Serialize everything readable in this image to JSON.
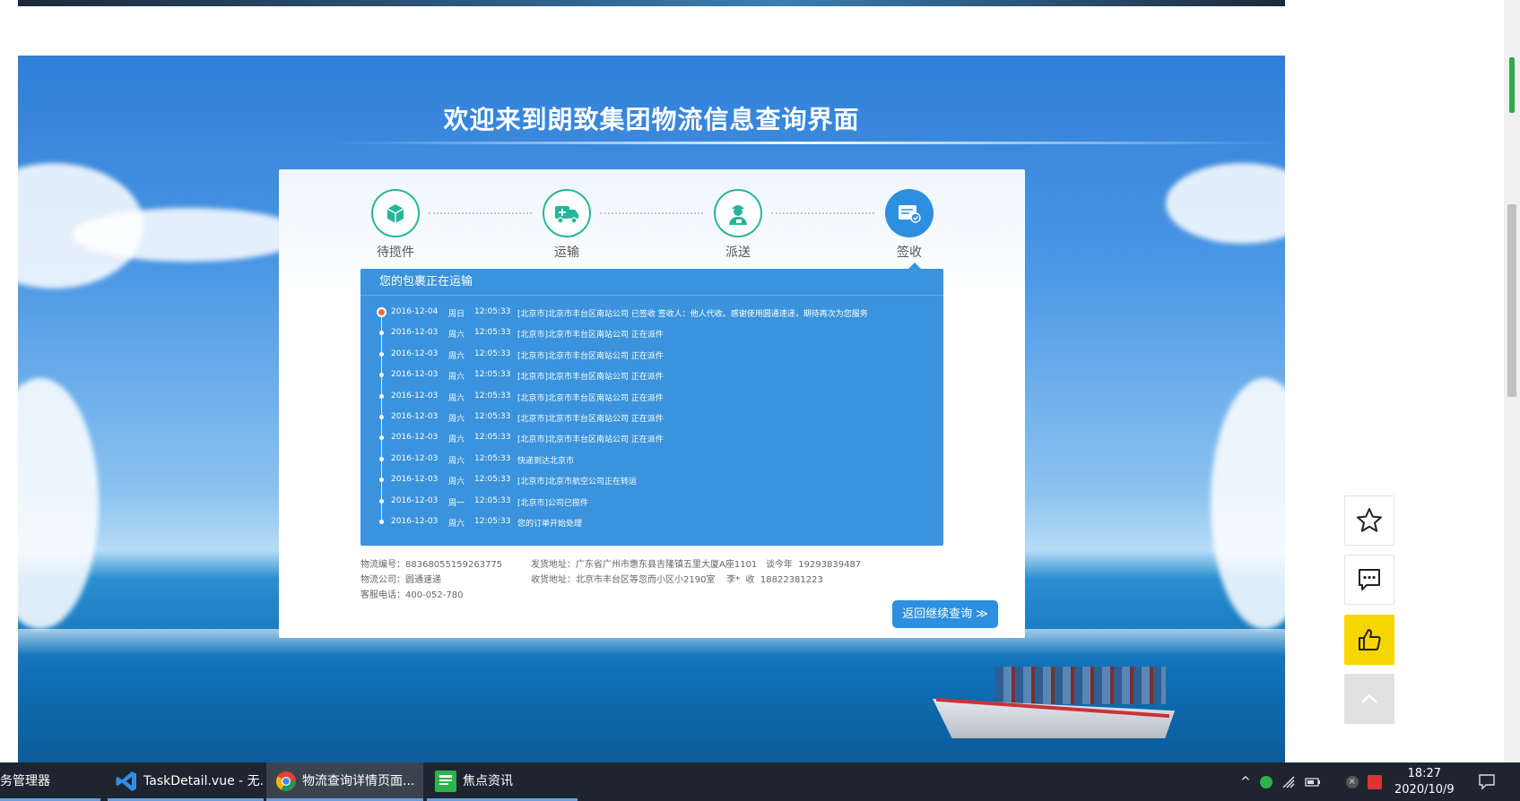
{
  "banner": {
    "title": "欢迎来到朗致集团物流信息查询界面"
  },
  "steps": [
    {
      "label": "待揽件",
      "icon": "box-icon"
    },
    {
      "label": "运输",
      "icon": "truck-icon"
    },
    {
      "label": "派送",
      "icon": "courier-icon"
    },
    {
      "label": "签收",
      "icon": "signed-receipt-icon"
    }
  ],
  "tracking": {
    "header": "您的包裹正在运输",
    "events": [
      {
        "date": "2016-12-04",
        "week": "周日",
        "time": "12:05:33",
        "text": "[北京市]北京市丰台区南站公司 已签收 签收人：他人代收。感谢使用圆通速递，期待再次为您服务"
      },
      {
        "date": "2016-12-03",
        "week": "周六",
        "time": "12:05:33",
        "text": "[北京市]北京市丰台区南站公司 正在派件"
      },
      {
        "date": "2016-12-03",
        "week": "周六",
        "time": "12:05:33",
        "text": "[北京市]北京市丰台区南站公司 正在派件"
      },
      {
        "date": "2016-12-03",
        "week": "周六",
        "time": "12:05:33",
        "text": "[北京市]北京市丰台区南站公司 正在派件"
      },
      {
        "date": "2016-12-03",
        "week": "周六",
        "time": "12:05:33",
        "text": "[北京市]北京市丰台区南站公司 正在派件"
      },
      {
        "date": "2016-12-03",
        "week": "周六",
        "time": "12:05:33",
        "text": "[北京市]北京市丰台区南站公司 正在派件"
      },
      {
        "date": "2016-12-03",
        "week": "周六",
        "time": "12:05:33",
        "text": "[北京市]北京市丰台区南站公司 正在派件"
      },
      {
        "date": "2016-12-03",
        "week": "周六",
        "time": "12:05:33",
        "text": "快递到达北京市"
      },
      {
        "date": "2016-12-03",
        "week": "周六",
        "time": "12:05:33",
        "text": "[北京市]北京市航空公司正在转运"
      },
      {
        "date": "2016-12-03",
        "week": "周一",
        "time": "12:05:33",
        "text": "[北京市]公司已揽件"
      },
      {
        "date": "2016-12-03",
        "week": "周六",
        "time": "12:05:33",
        "text": "您的订单开始处理"
      }
    ]
  },
  "info": {
    "tracking_no": "物流编号：88368055159263775",
    "company": "物流公司：圆通速递",
    "phone": "客服电话：400-052-780",
    "sender": "发货地址：广东省广州市惠东县吉隆镇五里大厦A座1101   谈今年  19293839487",
    "receiver": "收货地址：北京市丰台区等忽而小区小2190室    李*  收  18822381223"
  },
  "return_button": "返回继续查询 ≫",
  "side_buttons": [
    "star-icon",
    "comment-icon",
    "thumbs-up-icon",
    "back-to-top-icon"
  ],
  "colors": {
    "accent": "#2d8fe0",
    "panel": "#3a93dc",
    "step_border": "#26b59a",
    "like": "#f7d600",
    "dot_first": "#f36b3b"
  },
  "taskbar": {
    "items": [
      {
        "label": "务管理器"
      },
      {
        "label": "TaskDetail.vue - 无..."
      },
      {
        "label": "物流查询详情页面..."
      },
      {
        "label": "焦点资讯"
      }
    ],
    "time": "18:27",
    "date": "2020/10/9"
  }
}
